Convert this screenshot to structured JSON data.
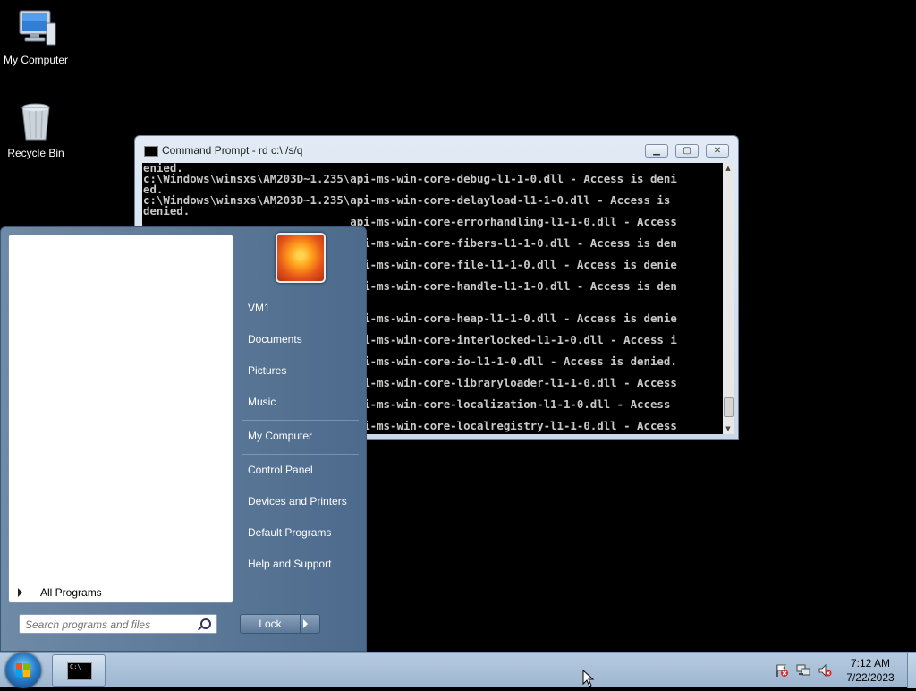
{
  "desktop": {
    "icons": [
      {
        "label": "My Computer",
        "icon": "computer-icon"
      },
      {
        "label": "Recycle Bin",
        "icon": "recycle-bin-icon"
      }
    ]
  },
  "cmd_window": {
    "title": "Command Prompt - rd  c:\\ /s/q",
    "lines": [
      "enied.",
      "c:\\Windows\\winsxs\\AM203D~1.235\\api-ms-win-core-debug-l1-1-0.dll - Access is deni",
      "ed.",
      "c:\\Windows\\winsxs\\AM203D~1.235\\api-ms-win-core-delayload-l1-1-0.dll - Access is",
      "denied.",
      "                               api-ms-win-core-errorhandling-l1-1-0.dll - Access",
      "",
      "                               api-ms-win-core-fibers-l1-1-0.dll - Access is den",
      "",
      "                               api-ms-win-core-file-l1-1-0.dll - Access is denie",
      "",
      "                               api-ms-win-core-handle-l1-1-0.dll - Access is den",
      "",
      "",
      "                               api-ms-win-core-heap-l1-1-0.dll - Access is denie",
      "",
      "                               api-ms-win-core-interlocked-l1-1-0.dll - Access i",
      "",
      "                               api-ms-win-core-io-l1-1-0.dll - Access is denied.",
      "",
      "                               api-ms-win-core-libraryloader-l1-1-0.dll - Access",
      "",
      "                               api-ms-win-core-localization-l1-1-0.dll - Access",
      "",
      "                               api-ms-win-core-localregistry-l1-1-0.dll - Access"
    ]
  },
  "start_menu": {
    "all_programs": "All Programs",
    "search_placeholder": "Search programs and files",
    "right_items": [
      "VM1",
      "Documents",
      "Pictures",
      "Music",
      "My Computer",
      "Control Panel",
      "Devices and Printers",
      "Default Programs",
      "Help and Support"
    ],
    "lock_label": "Lock"
  },
  "taskbar": {
    "time": "7:12 AM",
    "date": "7/22/2023",
    "tray_icons": [
      "action-center-icon",
      "network-icon",
      "volume-muted-icon"
    ]
  },
  "colors": {
    "desktop": "#000000",
    "console_text": "#c8c8c8",
    "start_menu": "#5a7798",
    "taskbar": "#a9c0d8"
  }
}
